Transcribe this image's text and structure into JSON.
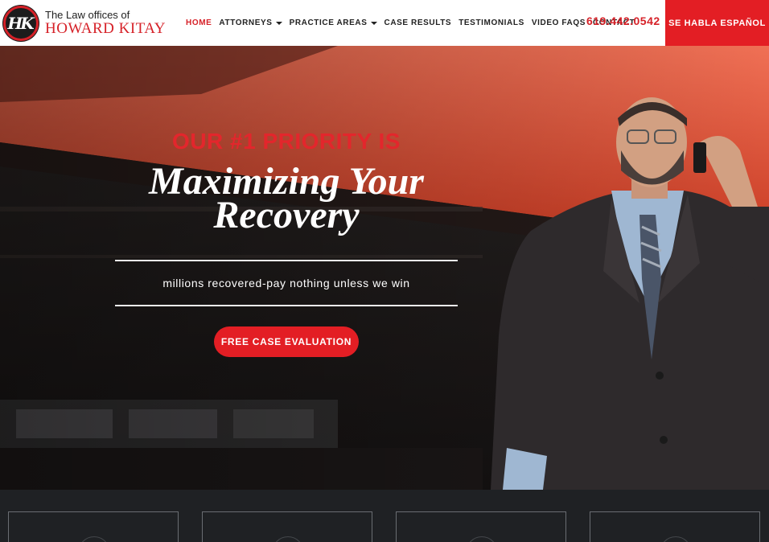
{
  "header": {
    "logo": {
      "monogram": "HK",
      "line1": "The Law offices of",
      "line2": "HOWARD KITAY"
    },
    "nav": [
      {
        "label": "HOME",
        "active": true,
        "dropdown": false
      },
      {
        "label": "ATTORNEYS",
        "active": false,
        "dropdown": true
      },
      {
        "label": "PRACTICE AREAS",
        "active": false,
        "dropdown": true
      },
      {
        "label": "CASE RESULTS",
        "active": false,
        "dropdown": false
      },
      {
        "label": "TESTIMONIALS",
        "active": false,
        "dropdown": false
      },
      {
        "label": "VIDEO FAQS",
        "active": false,
        "dropdown": false
      },
      {
        "label": "CONTACT",
        "active": false,
        "dropdown": false
      }
    ],
    "phone": "619.442.0542",
    "spanish_button": "SE HABLA ESPAÑOL"
  },
  "hero": {
    "eyebrow": "OUR #1 PRIORITY IS",
    "headline_line1": "Maximizing Your",
    "headline_line2": "Recovery",
    "tagline": "millions recovered-pay nothing unless we win",
    "cta_label": "FREE CASE EVALUATION"
  },
  "colors": {
    "accent_red": "#e31e24",
    "text_dark": "#222222",
    "footer_band": "#1f2124"
  },
  "icons": {
    "dropdown": "caret-down-icon"
  }
}
